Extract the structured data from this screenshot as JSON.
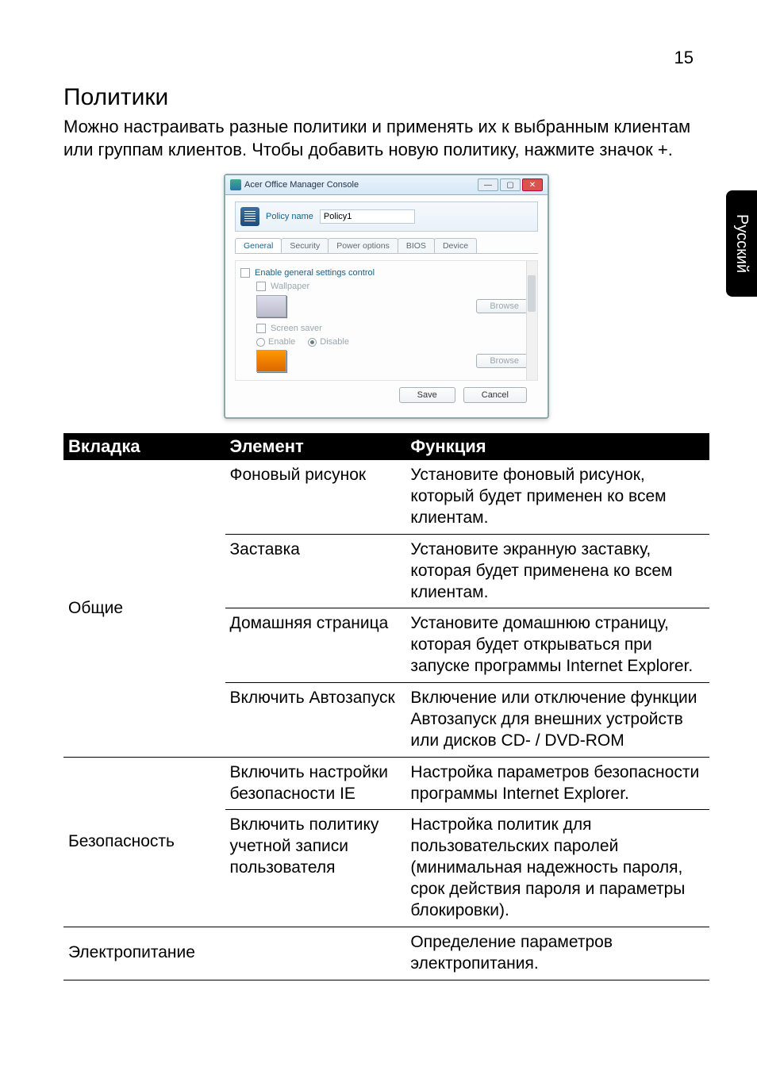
{
  "page_number": "15",
  "side_tab": "Русский",
  "heading": "Политики",
  "intro": "Можно настраивать разные политики и применять их к выбранным клиентам или группам клиентов. Чтобы добавить новую политику, нажмите значок +.",
  "dialog": {
    "title": "Acer Office Manager Console",
    "policy_name_label": "Policy name",
    "policy_name_value": "Policy1",
    "tabs": [
      "General",
      "Security",
      "Power options",
      "BIOS",
      "Device"
    ],
    "enable_general": "Enable general settings control",
    "wallpaper_label": "Wallpaper",
    "screen_saver_label": "Screen saver",
    "enable": "Enable",
    "disable": "Disable",
    "browse": "Browse",
    "save": "Save",
    "cancel": "Cancel"
  },
  "table": {
    "headers": {
      "tab": "Вкладка",
      "element": "Элемент",
      "function": "Функция"
    },
    "rows": [
      {
        "group": "Общие",
        "group_rowspan": 4,
        "element": "Фоновый рисунок",
        "function": "Установите фоновый рисунок, который будет применен ко всем клиентам.",
        "sep": true
      },
      {
        "element": "Заставка",
        "function": "Установите экранную заставку, которая будет применена ко всем клиентам.",
        "sep": true
      },
      {
        "element": "Домашняя страница",
        "function": "Установите домашнюю страницу, которая будет открываться при запуске программы Internet Explorer.",
        "sep": true
      },
      {
        "element": "Включить Автозапуск",
        "function": "Включение или отключение функции Автозапуск для внешних устройств или дисков CD- / DVD-ROM",
        "group_end": true
      },
      {
        "group": "Безопасность",
        "group_rowspan": 2,
        "element": "Включить настройки безопасности IE",
        "function": "Настройка параметров безопасности программы Internet Explorer.",
        "sep": true
      },
      {
        "element": "Включить политику учетной записи пользователя",
        "function": "Настройка политик для пользовательских паролей (минимальная надежность пароля, срок действия пароля и параметры блокировки).",
        "group_end": true
      },
      {
        "group": "Электропитание",
        "group_rowspan": 1,
        "element": "",
        "function": "Определение параметров электропитания.",
        "group_end": true
      }
    ]
  }
}
